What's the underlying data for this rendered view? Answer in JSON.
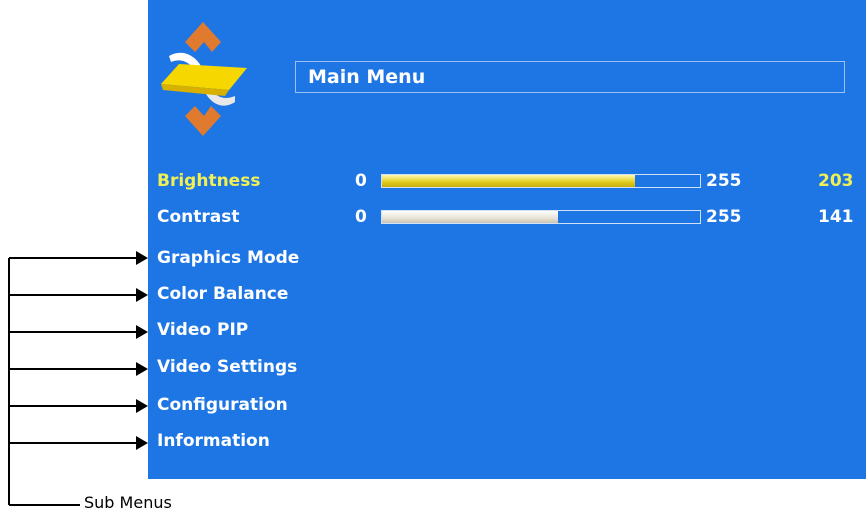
{
  "menu": {
    "title": "Main Menu",
    "sliders": [
      {
        "label": "Brightness",
        "min": "0",
        "max": "255",
        "value": "203",
        "fraction": 0.796,
        "selected": true
      },
      {
        "label": "Contrast",
        "min": "0",
        "max": "255",
        "value": "141",
        "fraction": 0.553,
        "selected": false
      }
    ],
    "items": [
      {
        "label": "Graphics Mode"
      },
      {
        "label": "Color Balance"
      },
      {
        "label": "Video PIP"
      },
      {
        "label": "Video Settings"
      },
      {
        "label": "Configuration"
      },
      {
        "label": "Information"
      }
    ]
  },
  "annotation": {
    "label": "Sub Menus"
  },
  "colors": {
    "background": "#1e76e4",
    "selected_text": "#f0ef56",
    "text": "#ffffff"
  }
}
